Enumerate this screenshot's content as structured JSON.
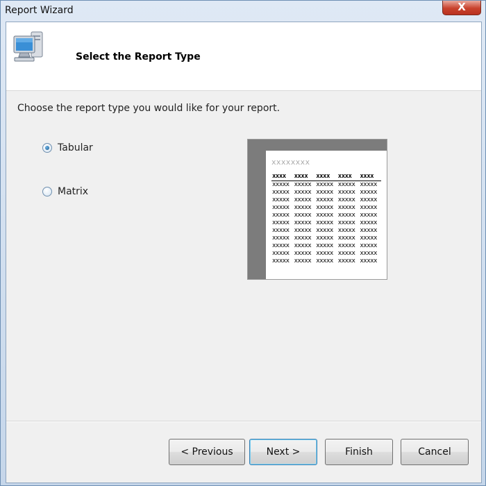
{
  "window": {
    "title": "Report Wizard",
    "close_glyph": "X"
  },
  "header": {
    "icon": "computer-icon",
    "title": "Select the Report Type"
  },
  "instruction": "Choose the report type you would like for your report.",
  "report_types": [
    {
      "label": "Tabular",
      "checked": true
    },
    {
      "label": "Matrix",
      "checked": false
    }
  ],
  "preview": {
    "title": "xxxxxxxx",
    "headers": [
      "xxxx",
      "xxxx",
      "xxxx",
      "xxxx",
      "xxxx"
    ],
    "rows": [
      [
        "xxxxx",
        "xxxxx",
        "xxxxx",
        "xxxxx",
        "xxxxx"
      ],
      [
        "xxxxx",
        "xxxxx",
        "xxxxx",
        "xxxxx",
        "xxxxx"
      ],
      [
        "xxxxx",
        "xxxxx",
        "xxxxx",
        "xxxxx",
        "xxxxx"
      ],
      [
        "xxxxx",
        "xxxxx",
        "xxxxx",
        "xxxxx",
        "xxxxx"
      ],
      [
        "xxxxx",
        "xxxxx",
        "xxxxx",
        "xxxxx",
        "xxxxx"
      ],
      [
        "xxxxx",
        "xxxxx",
        "xxxxx",
        "xxxxx",
        "xxxxx"
      ],
      [
        "xxxxx",
        "xxxxx",
        "xxxxx",
        "xxxxx",
        "xxxxx"
      ],
      [
        "xxxxx",
        "xxxxx",
        "xxxxx",
        "xxxxx",
        "xxxxx"
      ],
      [
        "xxxxx",
        "xxxxx",
        "xxxxx",
        "xxxxx",
        "xxxxx"
      ],
      [
        "xxxxx",
        "xxxxx",
        "xxxxx",
        "xxxxx",
        "xxxxx"
      ],
      [
        "xxxxx",
        "xxxxx",
        "xxxxx",
        "xxxxx",
        "xxxxx"
      ]
    ]
  },
  "buttons": {
    "previous": "< Previous",
    "next": "Next >",
    "finish": "Finish",
    "cancel": "Cancel"
  }
}
